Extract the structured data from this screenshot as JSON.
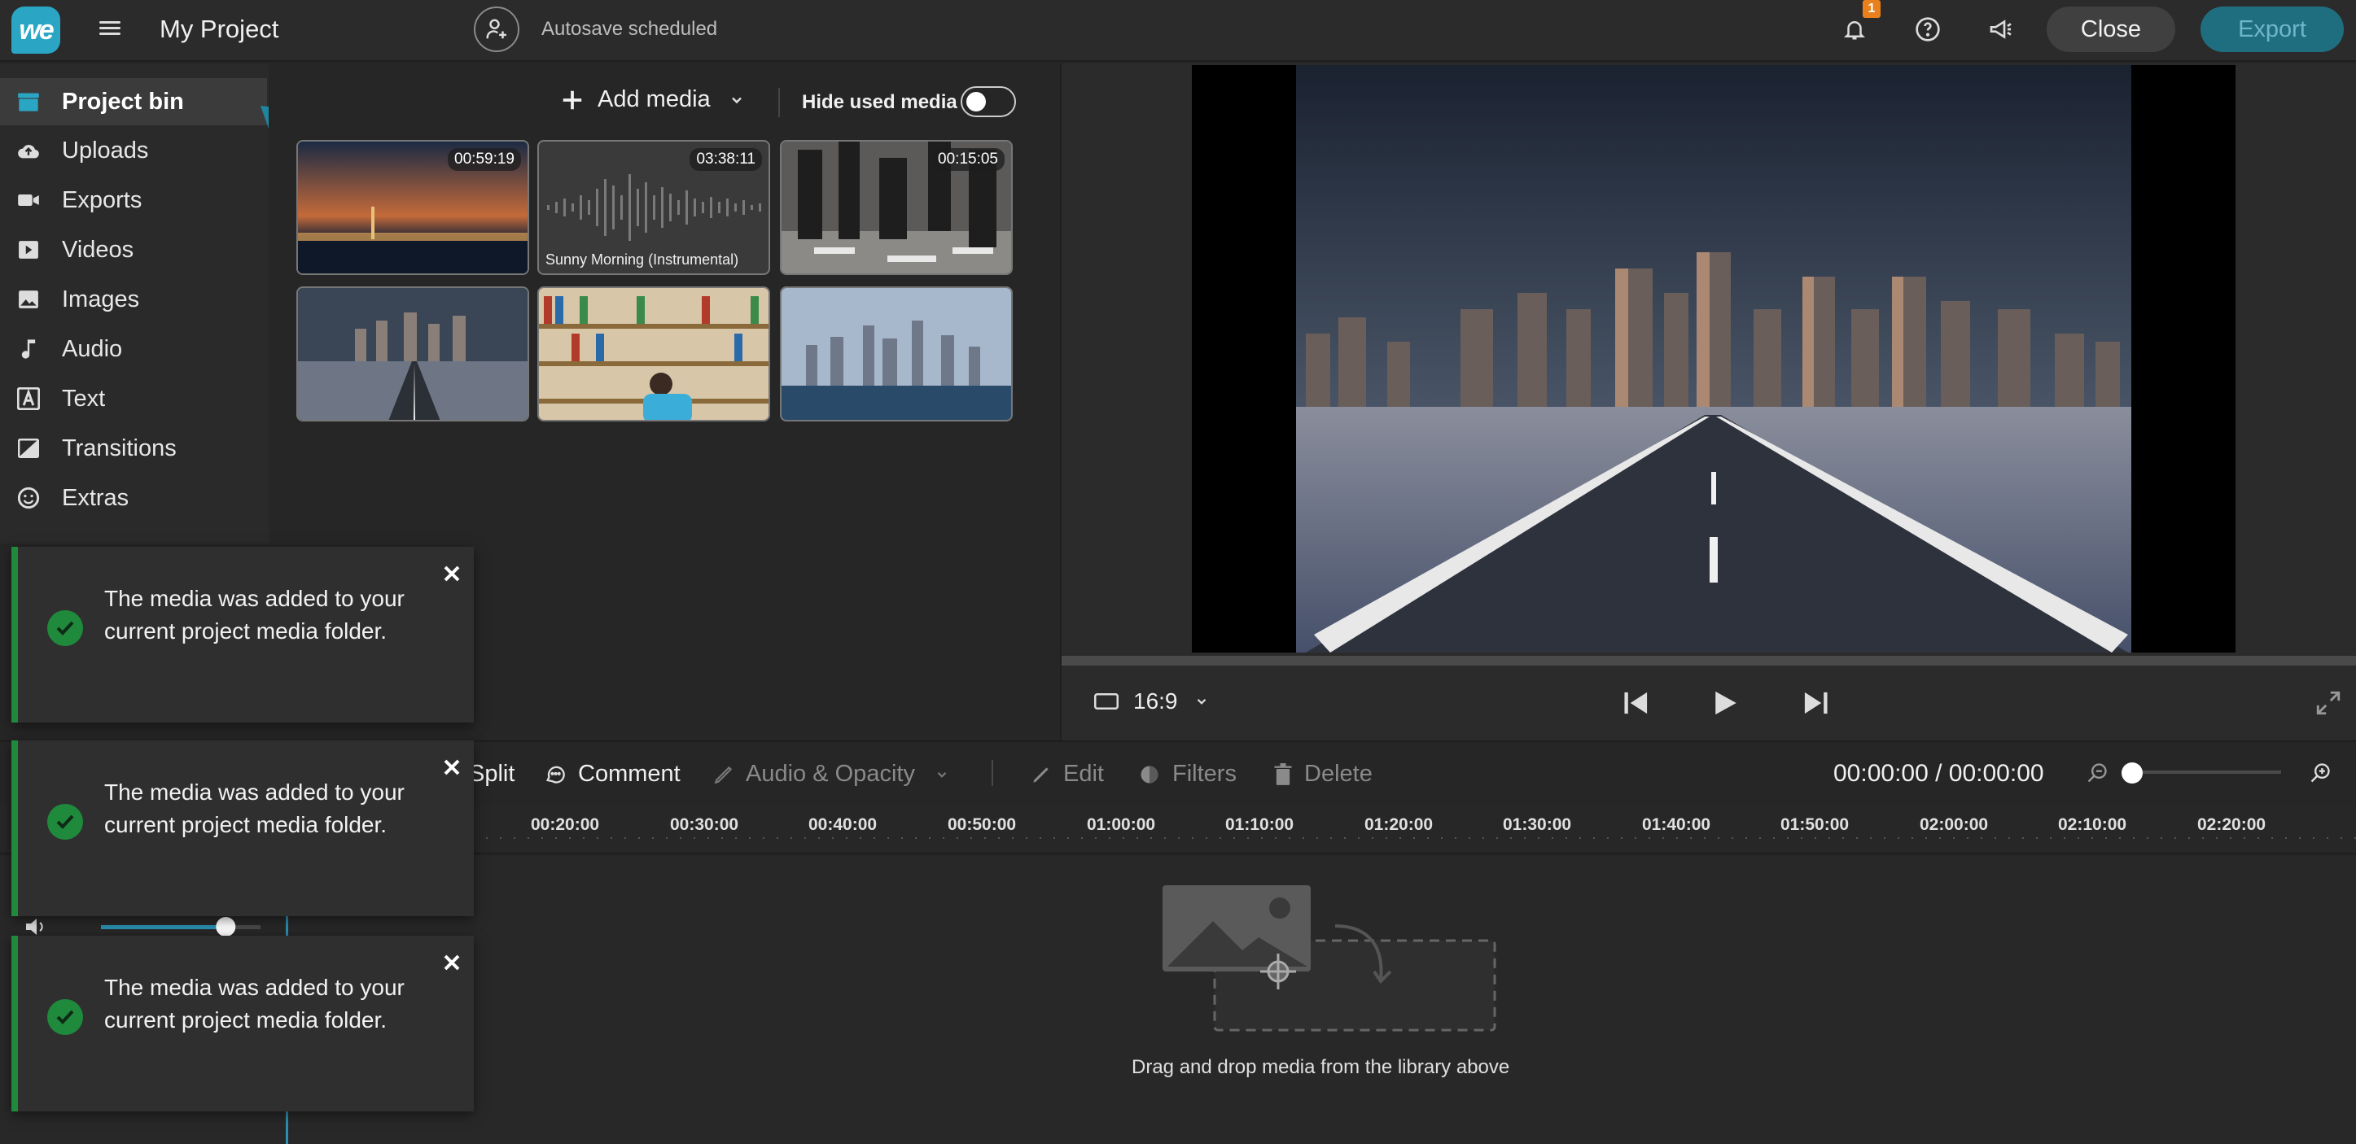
{
  "header": {
    "logo_text": "we",
    "project_title": "My Project",
    "autosave_status": "Autosave scheduled",
    "notification_count": "1",
    "close_label": "Close",
    "export_label": "Export"
  },
  "sidebar": {
    "items": [
      {
        "label": "Project bin",
        "icon": "folder-icon",
        "active": true
      },
      {
        "label": "Uploads",
        "icon": "cloud-upload-icon"
      },
      {
        "label": "Exports",
        "icon": "video-camera-icon"
      },
      {
        "label": "Videos",
        "icon": "play-square-icon"
      },
      {
        "label": "Images",
        "icon": "image-icon"
      },
      {
        "label": "Audio",
        "icon": "music-note-icon"
      },
      {
        "label": "Text",
        "icon": "text-icon"
      },
      {
        "label": "Transitions",
        "icon": "transition-icon"
      },
      {
        "label": "Extras",
        "icon": "smiley-icon"
      }
    ]
  },
  "bin": {
    "add_media_label": "Add media",
    "hide_used_label": "Hide used media",
    "hide_used_on": false,
    "media": [
      {
        "type": "video",
        "duration": "00:59:19",
        "label": ""
      },
      {
        "type": "audio",
        "duration": "03:38:11",
        "label": "Sunny Morning (Instrumental)"
      },
      {
        "type": "video",
        "duration": "00:15:05",
        "label": ""
      },
      {
        "type": "image",
        "duration": "",
        "label": ""
      },
      {
        "type": "image",
        "duration": "",
        "label": ""
      },
      {
        "type": "image",
        "duration": "",
        "label": ""
      }
    ]
  },
  "preview": {
    "aspect_ratio": "16:9"
  },
  "toolbar": {
    "split_label": "Split",
    "comment_label": "Comment",
    "audio_opacity_label": "Audio & Opacity",
    "edit_label": "Edit",
    "filters_label": "Filters",
    "delete_label": "Delete",
    "timecode": "00:00:00 / 00:00:00",
    "zoom_level": 0
  },
  "timeline": {
    "ticks": [
      "00:20:00",
      "00:30:00",
      "00:40:00",
      "00:50:00",
      "01:00:00",
      "01:10:00",
      "01:20:00",
      "01:30:00",
      "01:40:00",
      "01:50:00",
      "02:00:00",
      "02:10:00",
      "02:20:00"
    ],
    "drop_hint": "Drag and drop media from the library above",
    "volume_level": 0.73
  },
  "toasts": [
    {
      "message": "The media was added to your current project media folder."
    },
    {
      "message": "The media was added to your current project media folder."
    },
    {
      "message": "The media was added to your current project media folder."
    }
  ],
  "colors": {
    "accent": "#2aa6c4",
    "success": "#1f8a3c",
    "badge": "#e8811d",
    "export_bg": "#1f6e80"
  }
}
